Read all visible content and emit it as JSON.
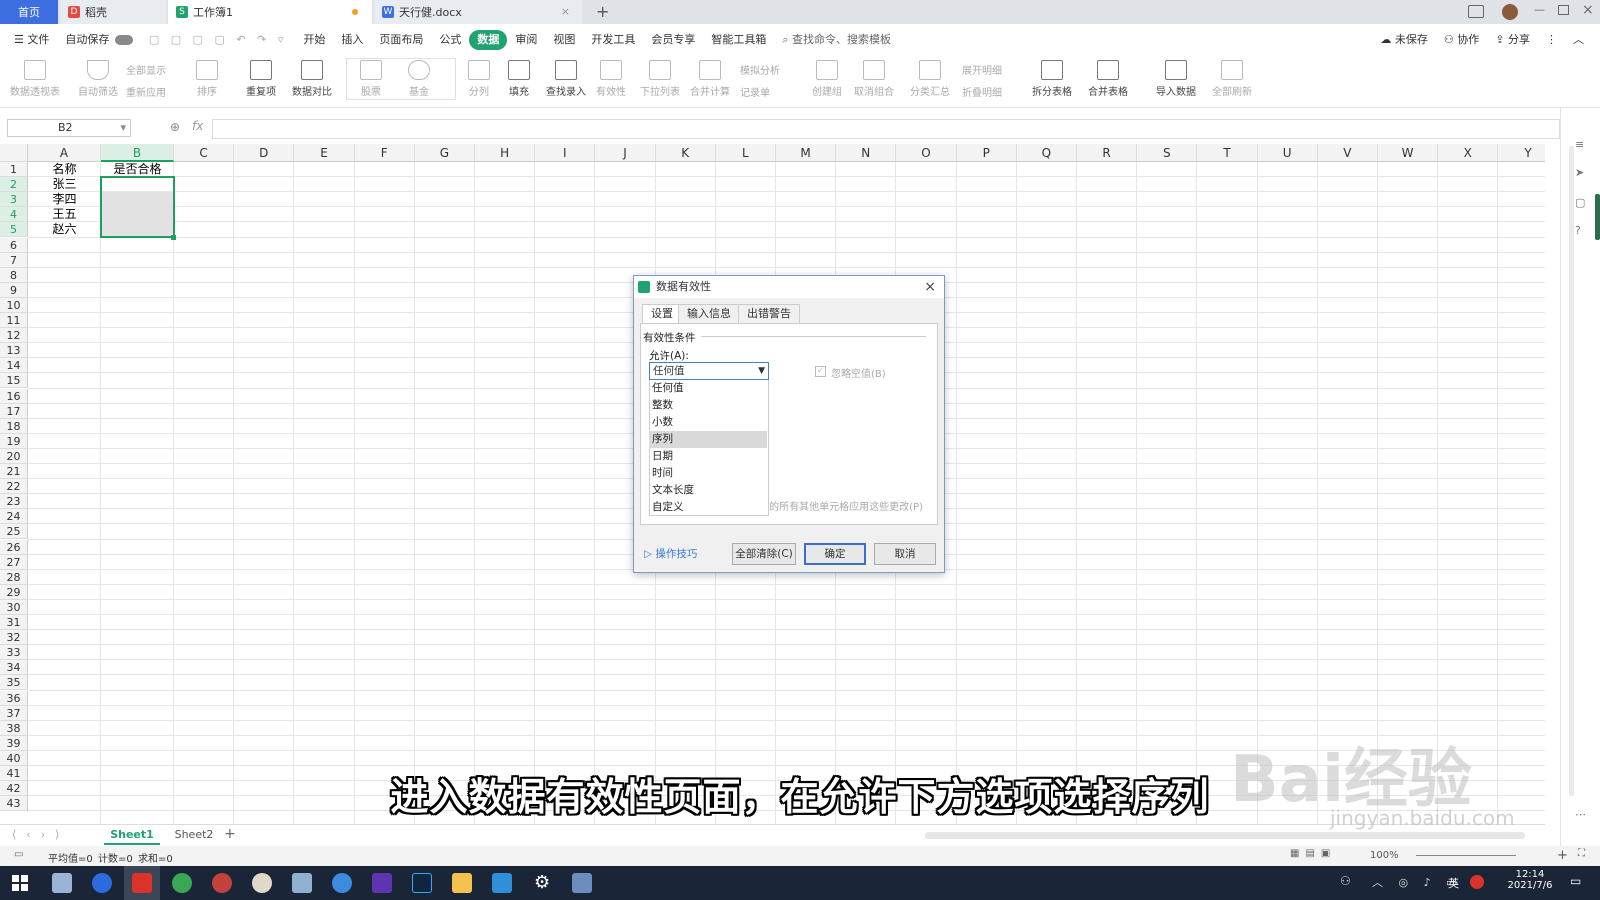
{
  "tabs": [
    {
      "label": "首页"
    },
    {
      "label": "稻壳"
    },
    {
      "label": "工作簿1"
    },
    {
      "label": "天行健.docx"
    }
  ],
  "menubar": {
    "file": "文件",
    "autosave": "自动保存",
    "items": [
      "开始",
      "插入",
      "页面布局",
      "公式",
      "数据",
      "审阅",
      "视图",
      "开发工具",
      "会员专享",
      "智能工具箱"
    ],
    "active": "数据",
    "search": "查找命令、搜索模板",
    "unsaved": "未保存",
    "collab": "协作",
    "share": "分享"
  },
  "ribbon": {
    "pivot": "数据透视表",
    "autofilter": "自动筛选",
    "showall": "全部显示",
    "reapply": "重新应用",
    "sort": "排序",
    "duplicates": "重复项",
    "compare": "数据对比",
    "stocks": "股票",
    "fund": "基金",
    "split": "分列",
    "fill": "填充",
    "lookup": "查找录入",
    "validity": "有效性",
    "dropdown": "下拉列表",
    "consolidate": "合并计算",
    "whatif": "模拟分析",
    "record": "记录单",
    "group": "创建组",
    "ungroup": "取消组合",
    "subtotal": "分类汇总",
    "expand": "展开明细",
    "collapse": "折叠明细",
    "splittable": "拆分表格",
    "mergetable": "合并表格",
    "import": "导入数据",
    "refresh": "全部刷新"
  },
  "formula": {
    "namebox": "B2",
    "fx": "fx",
    "value": ""
  },
  "columns": [
    "A",
    "B",
    "C",
    "D",
    "E",
    "F",
    "G",
    "H",
    "I",
    "J",
    "K",
    "L",
    "M",
    "N",
    "O",
    "P",
    "Q",
    "R",
    "S",
    "T",
    "U",
    "V",
    "W",
    "X",
    "Y"
  ],
  "cells": {
    "A1": "名称",
    "B1": "是否合格",
    "A2": "张三",
    "A3": "李四",
    "A4": "王五",
    "A5": "赵六"
  },
  "sheets": {
    "tabs": [
      "Sheet1",
      "Sheet2"
    ],
    "active": "Sheet1"
  },
  "status": {
    "avg": "平均值=0",
    "count": "计数=0",
    "sum": "求和=0",
    "zoom": "100%"
  },
  "dialog": {
    "title": "数据有效性",
    "tabs": [
      "设置",
      "输入信息",
      "出错警告"
    ],
    "section": "有效性条件",
    "allow_label": "允许(A):",
    "allow_value": "任何值",
    "ignore_blank": "忽略空值(B)",
    "options": [
      "任何值",
      "整数",
      "小数",
      "序列",
      "日期",
      "时间",
      "文本长度",
      "自定义"
    ],
    "highlighted": "序列",
    "apply_all": "对有同样设置的所有其他单元格应用这些更改(P)",
    "tips": "操作技巧",
    "clear_all": "全部清除(C)",
    "ok": "确定",
    "cancel": "取消"
  },
  "subtitle": "进入数据有效性页面，在允许下方选项选择序列",
  "watermark": {
    "brand": "Bai经验",
    "url": "jingyan.baidu.com"
  },
  "taskbar": {
    "time": "12:14",
    "date": "2021/7/6",
    "ime": "英"
  },
  "colors": {
    "accent": "#20a370",
    "selection": "#1e9e5f",
    "taskbar": "#1a2637"
  }
}
